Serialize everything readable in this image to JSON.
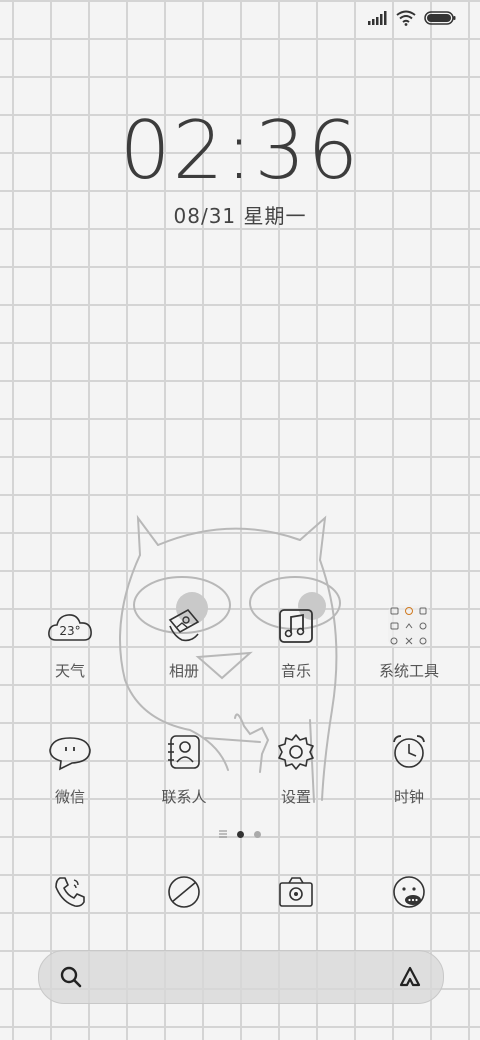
{
  "status_bar": {
    "signal_icon": "signal-bars-icon",
    "wifi_icon": "wifi-icon",
    "battery_icon": "battery-icon"
  },
  "lock_clock": {
    "time": "02:36",
    "date": "08/31 星期一"
  },
  "apps_row1": [
    {
      "label": "天气",
      "icon": "weather-cloud-icon",
      "temp": "23°"
    },
    {
      "label": "相册",
      "icon": "gallery-icon"
    },
    {
      "label": "音乐",
      "icon": "music-icon"
    },
    {
      "label": "系统工具",
      "icon": "system-tools-folder-icon"
    }
  ],
  "apps_row2": [
    {
      "label": "微信",
      "icon": "wechat-icon"
    },
    {
      "label": "联系人",
      "icon": "contacts-icon"
    },
    {
      "label": "设置",
      "icon": "settings-gear-icon"
    },
    {
      "label": "时钟",
      "icon": "alarm-clock-icon"
    }
  ],
  "page_indicator": {
    "pages": 2,
    "current": 1
  },
  "dock": [
    {
      "icon": "phone-icon"
    },
    {
      "icon": "browser-icon"
    },
    {
      "icon": "camera-icon"
    },
    {
      "icon": "messages-icon"
    }
  ],
  "search_bar": {
    "left_icon": "search-icon",
    "right_icon": "assistant-icon"
  },
  "colors": {
    "grid_line": "#d4d4d4",
    "background": "#f4f4f4",
    "icon_stroke": "#333333",
    "label": "#555555"
  }
}
